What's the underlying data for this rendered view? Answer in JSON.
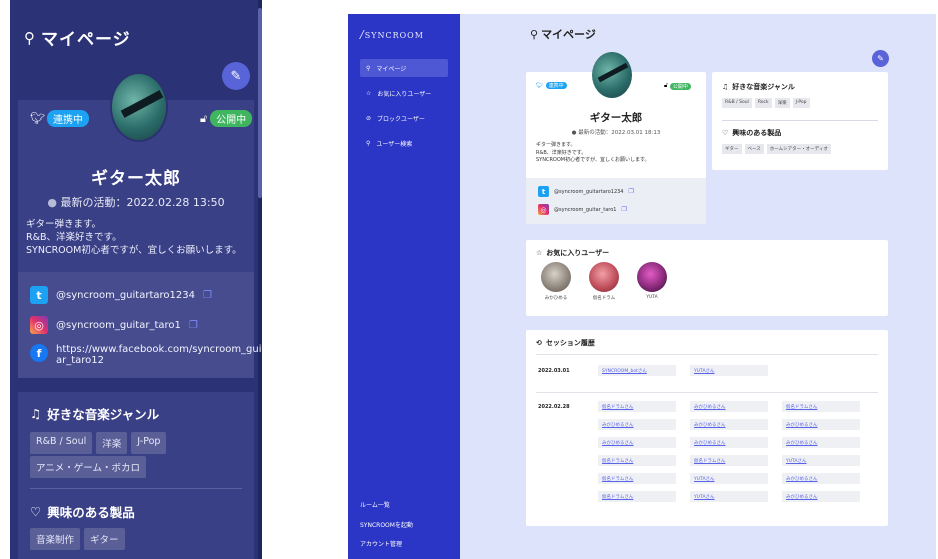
{
  "mobile": {
    "title": "マイページ",
    "twitter_badge": "連携中",
    "public_badge": "公開中",
    "name": "ギター太郎",
    "activity": "最新の活動：2022.02.28 13:50",
    "bio": [
      "ギター弾きます。",
      "R&B、洋楽好きです。",
      "SYNCROOM初心者ですが、宜しくお願いします。"
    ],
    "links": {
      "twitter": "@syncroom_guitartaro1234",
      "instagram": "@syncroom_guitar_taro1",
      "facebook_line1": "https://www.facebook.com/syncroom_guit",
      "facebook_line2": "ar_taro12"
    },
    "genre_title": "好きな音楽ジャンル",
    "genres_row1": [
      "R&B / Soul",
      "洋楽",
      "J-Pop"
    ],
    "genres_row2": [
      "アニメ・ゲーム・ボカロ"
    ],
    "products_title": "興味のある製品",
    "products": [
      "音楽制作",
      "ギター"
    ]
  },
  "desktop": {
    "brand": "SYNCROOM",
    "sidebar": {
      "items": [
        {
          "icon": "user-icon",
          "label": "マイページ"
        },
        {
          "icon": "star-icon",
          "label": "お気に入りユーザー"
        },
        {
          "icon": "block-icon",
          "label": "ブロックユーザー"
        },
        {
          "icon": "search-icon",
          "label": "ユーザー検索"
        }
      ],
      "bottom": [
        "ルーム一覧",
        "SYNCROOMを起動",
        "アカウント管理"
      ]
    },
    "title": "マイページ",
    "twitter_badge": "連携中",
    "public_badge": "公開中",
    "name": "ギター太郎",
    "activity": "最新の活動：2022.03.01 18:13",
    "bio": [
      "ギター弾きます。",
      "R&B、洋楽好きです。",
      "SYNCROOM初心者ですが、宜しくお願いします。"
    ],
    "links": {
      "twitter": "@syncroom_guitartaro1234",
      "instagram": "@syncroom_guitar_taro1"
    },
    "genre_title": "好きな音楽ジャンル",
    "genres": [
      "R&B / Soul",
      "Rock",
      "洋楽",
      "J-Pop"
    ],
    "products_title": "興味のある製品",
    "products": [
      "ギター",
      "ベース",
      "ホームシアター・オーディオ"
    ],
    "favorites_title": "お気に入りユーザー",
    "favorites": [
      {
        "name": "みかひめる",
        "color": "#8a8178"
      },
      {
        "name": "仮名ドラム",
        "color": "#c0505c"
      },
      {
        "name": "YUTA",
        "color": "#8a2a7a"
      }
    ],
    "sessions_title": "セッション履歴",
    "sessions": [
      {
        "date": "2022.03.01",
        "rows": [
          [
            "SYNCROOM_botさん",
            "YUTAさん",
            ""
          ]
        ]
      },
      {
        "date": "2022.02.28",
        "rows": [
          [
            "仮名ドラムさん",
            "みかひめるさん",
            "仮名ドラムさん"
          ],
          [
            "みかひめるさん",
            "みかひめるさん",
            "みかひめるさん"
          ],
          [
            "みかひめるさん",
            "みかひめるさん",
            "みかひめるさん"
          ],
          [
            "仮名ドラムさん",
            "仮名ドラムさん",
            "YUTAさん"
          ],
          [
            "仮名ドラムさん",
            "YUTAさん",
            "みかひめるさん"
          ],
          [
            "仮名ドラムさん",
            "YUTAさん",
            "みかひめるさん"
          ]
        ]
      }
    ]
  }
}
